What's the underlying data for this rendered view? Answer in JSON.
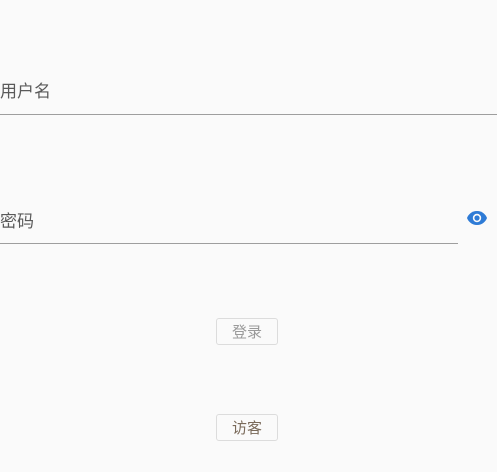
{
  "form": {
    "username_placeholder": "用户名",
    "password_placeholder": "密码",
    "toggle_password_icon": "eye-icon",
    "login_label": "登录",
    "guest_label": "访客"
  },
  "colors": {
    "accent": "#2e7bd6",
    "underline": "#9e9e9e",
    "background": "#fafafa"
  }
}
